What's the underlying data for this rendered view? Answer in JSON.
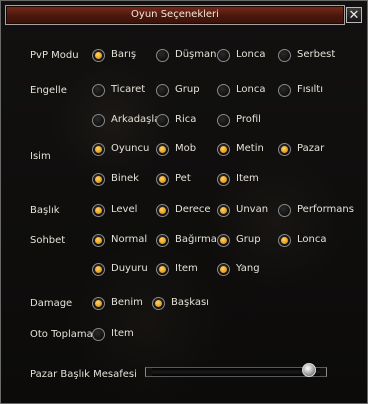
{
  "window": {
    "title": "Oyun Seçenekleri",
    "close_glyph": "✕"
  },
  "rows": [
    {
      "label": "PvP Modu",
      "options": [
        {
          "text": "Barış",
          "selected": true
        },
        {
          "text": "Düşman",
          "selected": false
        },
        {
          "text": "Lonca",
          "selected": false
        },
        {
          "text": "Serbest",
          "selected": false
        }
      ]
    },
    {
      "label": "Engelle",
      "options": [
        {
          "text": "Ticaret",
          "selected": false
        },
        {
          "text": "Grup",
          "selected": false
        },
        {
          "text": "Lonca",
          "selected": false
        },
        {
          "text": "Fısıltı",
          "selected": false
        },
        {
          "text": "Arkadaşlar",
          "selected": false
        },
        {
          "text": "Rica",
          "selected": false
        },
        {
          "text": "Profil",
          "selected": false
        }
      ]
    },
    {
      "label": "Isim",
      "options": [
        {
          "text": "Oyuncu",
          "selected": true
        },
        {
          "text": "Mob",
          "selected": true
        },
        {
          "text": "Metin",
          "selected": true
        },
        {
          "text": "Pazar",
          "selected": true
        },
        {
          "text": "Binek",
          "selected": true
        },
        {
          "text": "Pet",
          "selected": true
        },
        {
          "text": "Item",
          "selected": true
        }
      ]
    },
    {
      "label": "Başlık",
      "options": [
        {
          "text": "Level",
          "selected": true
        },
        {
          "text": "Derece",
          "selected": true
        },
        {
          "text": "Unvan",
          "selected": true
        },
        {
          "text": "Performans",
          "selected": false
        }
      ]
    },
    {
      "label": "Sohbet",
      "options": [
        {
          "text": "Normal",
          "selected": true
        },
        {
          "text": "Bağırma",
          "selected": true
        },
        {
          "text": "Grup",
          "selected": true
        },
        {
          "text": "Lonca",
          "selected": true
        },
        {
          "text": "Duyuru",
          "selected": true
        },
        {
          "text": "Item",
          "selected": true
        },
        {
          "text": "Yang",
          "selected": true
        }
      ]
    },
    {
      "label": "Damage",
      "options": [
        {
          "text": "Benim",
          "selected": true
        },
        {
          "text": "Başkası",
          "selected": true
        }
      ]
    },
    {
      "label": "Oto Toplama",
      "options": [
        {
          "text": "Item",
          "selected": false
        }
      ]
    }
  ],
  "slider": {
    "label": "Pazar Başlık Mesafesi",
    "value_fraction": 0.93
  },
  "colors": {
    "title_bar": "#5a1c10",
    "radio_selected": "#f0a020",
    "background": "#0f0e0d"
  }
}
